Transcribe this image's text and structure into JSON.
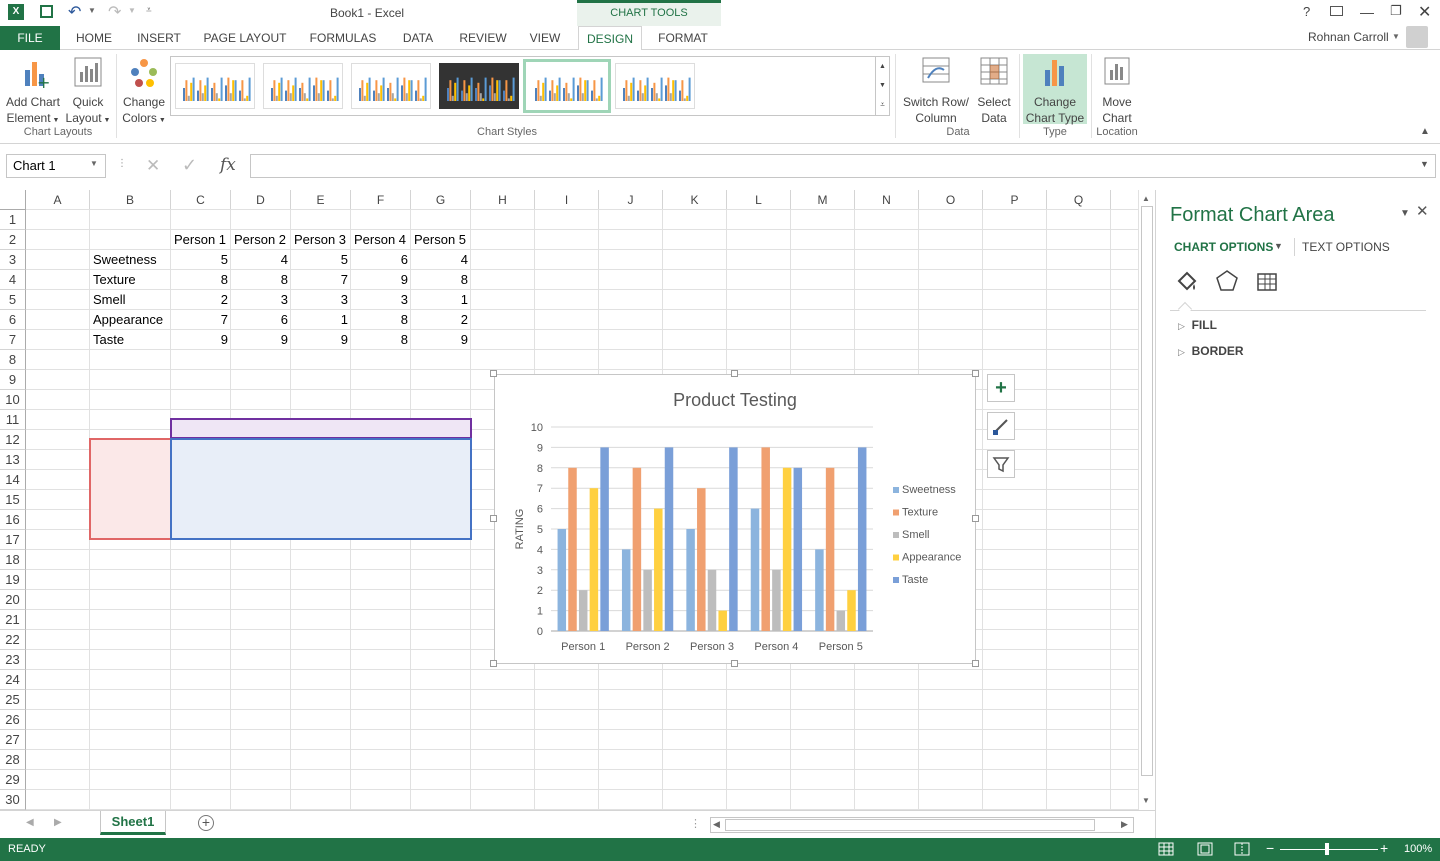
{
  "title": "Book1 - Excel",
  "context_tab_group": "CHART TOOLS",
  "user": "Rohnan Carroll",
  "tabs": [
    "FILE",
    "HOME",
    "INSERT",
    "PAGE LAYOUT",
    "FORMULAS",
    "DATA",
    "REVIEW",
    "VIEW",
    "DESIGN",
    "FORMAT"
  ],
  "ribbon": {
    "add_chart_element": [
      "Add Chart",
      "Element"
    ],
    "quick_layout": [
      "Quick",
      "Layout"
    ],
    "change_colors": [
      "Change",
      "Colors"
    ],
    "switch_row": [
      "Switch Row/",
      "Column"
    ],
    "select_data": [
      "Select",
      "Data"
    ],
    "change_chart_type": [
      "Change",
      "Chart Type"
    ],
    "move_chart": [
      "Move",
      "Chart"
    ],
    "groups": {
      "chart_layouts": "Chart Layouts",
      "chart_styles": "Chart Styles",
      "data": "Data",
      "type": "Type",
      "location": "Location"
    }
  },
  "formula": {
    "name_box": "Chart 1",
    "fx": "fx"
  },
  "columns": [
    "A",
    "B",
    "C",
    "D",
    "E",
    "F",
    "G",
    "H",
    "I",
    "J",
    "K",
    "L",
    "M",
    "N",
    "O",
    "P",
    "Q"
  ],
  "rows": [
    "1",
    "2",
    "3",
    "4",
    "5",
    "6",
    "7",
    "8",
    "9",
    "10",
    "11",
    "12",
    "13",
    "14",
    "15",
    "16",
    "17",
    "18",
    "19",
    "20",
    "21",
    "22",
    "23",
    "24",
    "25",
    "26",
    "27",
    "28",
    "29",
    "30"
  ],
  "table": {
    "headers": [
      "Person 1",
      "Person 2",
      "Person 3",
      "Person 4",
      "Person 5"
    ],
    "row_labels": [
      "Sweetness",
      "Texture",
      "Smell",
      "Appearance",
      "Taste"
    ],
    "values": [
      [
        "5",
        "4",
        "5",
        "6",
        "4"
      ],
      [
        "8",
        "8",
        "7",
        "9",
        "8"
      ],
      [
        "2",
        "3",
        "3",
        "3",
        "1"
      ],
      [
        "7",
        "6",
        "1",
        "8",
        "2"
      ],
      [
        "9",
        "9",
        "9",
        "8",
        "9"
      ]
    ]
  },
  "chart_data": {
    "type": "bar",
    "title": "Product Testing",
    "ylabel": "RATING",
    "xlabel": "",
    "categories": [
      "Person 1",
      "Person 2",
      "Person 3",
      "Person 4",
      "Person 5"
    ],
    "ylim": [
      0,
      10
    ],
    "yticks": [
      "0",
      "1",
      "2",
      "3",
      "4",
      "5",
      "6",
      "7",
      "8",
      "9",
      "10"
    ],
    "grid": true,
    "legend": "right",
    "series": [
      {
        "name": "Sweetness",
        "values": [
          5,
          4,
          5,
          6,
          4
        ],
        "color": "#8cb4de"
      },
      {
        "name": "Texture",
        "values": [
          8,
          8,
          7,
          9,
          8
        ],
        "color": "#f0a070"
      },
      {
        "name": "Smell",
        "values": [
          2,
          3,
          3,
          3,
          1
        ],
        "color": "#bdbdbd"
      },
      {
        "name": "Appearance",
        "values": [
          7,
          6,
          1,
          8,
          2
        ],
        "color": "#ffd040"
      },
      {
        "name": "Taste",
        "values": [
          9,
          9,
          9,
          8,
          9
        ],
        "color": "#7a9fd8"
      }
    ]
  },
  "pane": {
    "title": "Format Chart Area",
    "tab_chart": "CHART OPTIONS",
    "tab_text": "TEXT OPTIONS",
    "fill": "FILL",
    "border": "BORDER"
  },
  "sheet_tab": "Sheet1",
  "status": {
    "ready": "READY",
    "zoom": "100%"
  },
  "colors": {
    "accent": "#217346",
    "selection_purple": "#7030a0",
    "selection_red": "#e06666",
    "selection_blue": "#4472c4"
  }
}
